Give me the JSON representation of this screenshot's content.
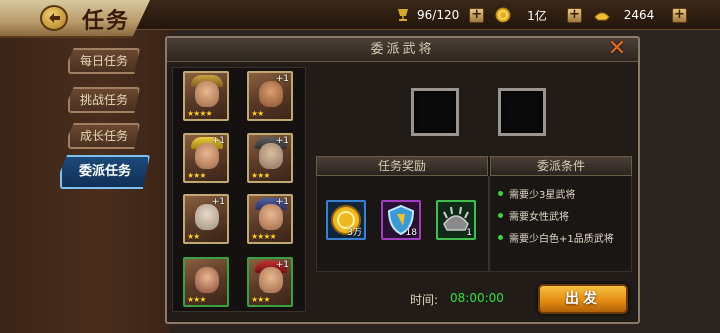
{
  "header": {
    "title": "任务",
    "resources": [
      {
        "icon": "trophy-icon",
        "value": "96/120"
      },
      {
        "icon": "gold-coin-icon",
        "value": "1亿"
      },
      {
        "icon": "gold-ingot-icon",
        "value": "2464"
      }
    ]
  },
  "sidebar": {
    "tabs": [
      {
        "label": "每日任务"
      },
      {
        "label": "挑战任务"
      },
      {
        "label": "成长任务"
      },
      {
        "label": "委派任务"
      }
    ]
  },
  "dialog": {
    "title": "委派武将",
    "reward_header": "任务奖励",
    "condition_header": "委派条件",
    "rewards": [
      {
        "icon": "gold-coin-icon",
        "count": "3万"
      },
      {
        "icon": "shield-icon",
        "count": "18"
      },
      {
        "icon": "spiked-helmet-icon",
        "count": "1"
      }
    ],
    "conditions": [
      "需要少3星武将",
      "需要女性武将",
      "需要少白色+1品质武将"
    ],
    "time_label": "时间:",
    "time_value": "08:00:00",
    "go_label": "出发"
  },
  "heroes": [
    {
      "plus": "",
      "stars": "★★★★"
    },
    {
      "plus": "+1",
      "stars": "★★"
    },
    {
      "plus": "+1",
      "stars": "★★★"
    },
    {
      "plus": "+1",
      "stars": "★★★"
    },
    {
      "plus": "+1",
      "stars": "★★"
    },
    {
      "plus": "+1",
      "stars": "★★★★"
    },
    {
      "plus": "",
      "stars": "★★★"
    },
    {
      "plus": "+1",
      "stars": "★★★"
    }
  ]
}
